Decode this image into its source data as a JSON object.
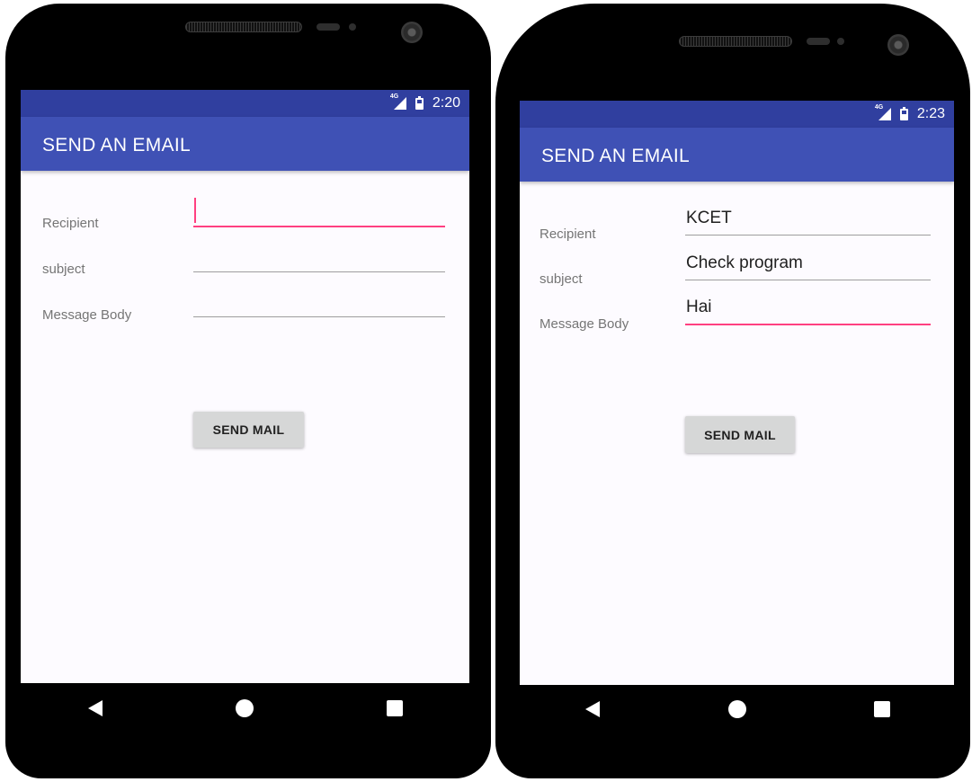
{
  "left_screen": {
    "status_time": "2:20",
    "network": "4G",
    "title": "SEND AN EMAIL",
    "recipient_label": "Recipient",
    "subject_label": "subject",
    "body_label": "Message Body",
    "recipient_value": "",
    "subject_value": "",
    "body_value": "",
    "send_label": "SEND MAIL"
  },
  "right_screen": {
    "status_time": "2:23",
    "network": "4G",
    "title": "SEND AN EMAIL",
    "recipient_label": "Recipient",
    "subject_label": "subject",
    "body_label": "Message Body",
    "recipient_value": "KCET",
    "subject_value": "Check program",
    "body_value": "Hai",
    "send_label": "SEND MAIL"
  },
  "colors": {
    "status_bar": "#303f9f",
    "app_bar": "#3f51b5",
    "accent": "#ff4081",
    "background": "#fdfbff",
    "button": "#d6d7d7"
  },
  "icons": {
    "signal": "cell-signal-icon",
    "battery": "battery-icon",
    "back": "back-triangle-icon",
    "home": "home-circle-icon",
    "recent": "recent-apps-square-icon"
  }
}
